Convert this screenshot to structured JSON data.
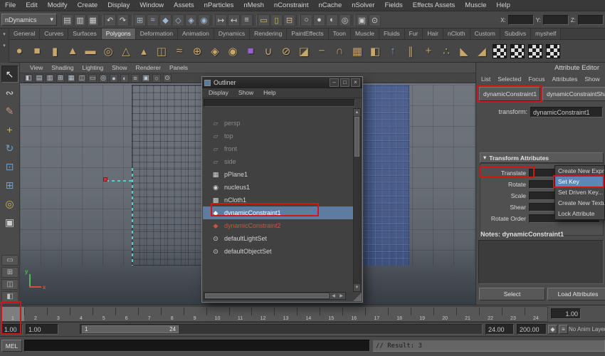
{
  "menubar": {
    "items": [
      "File",
      "Edit",
      "Modify",
      "Create",
      "Display",
      "Window",
      "Assets",
      "nParticles",
      "nMesh",
      "nConstraint",
      "nCache",
      "nSolver",
      "Fields",
      "Effects Assets",
      "Muscle",
      "Help"
    ]
  },
  "statusline": {
    "mode": "nDynamics",
    "caret": "▾",
    "icons": [
      {
        "name": "scene-new-icon",
        "g": "▤",
        "c": "#d0d0d0"
      },
      {
        "name": "scene-open-icon",
        "g": "▥",
        "c": "#d0d0d0"
      },
      {
        "name": "scene-save-icon",
        "g": "▦",
        "c": "#d0d0d0"
      },
      {
        "name": "separator",
        "sep": true
      },
      {
        "name": "undo-icon",
        "g": "↶",
        "c": "#d0d0d0"
      },
      {
        "name": "redo-icon",
        "g": "↷",
        "c": "#d0d0d0"
      },
      {
        "name": "separator",
        "sep": true
      },
      {
        "name": "snap-grid-icon",
        "g": "⊞",
        "c": "#9db7d8"
      },
      {
        "name": "snap-curve-icon",
        "g": "≈",
        "c": "#9db7d8"
      },
      {
        "name": "snap-point-icon",
        "g": "◆",
        "c": "#9db7d8"
      },
      {
        "name": "snap-plane-icon",
        "g": "◇",
        "c": "#9db7d8"
      },
      {
        "name": "snap-surface-icon",
        "g": "◈",
        "c": "#9db7d8"
      },
      {
        "name": "make-live-icon",
        "g": "◉",
        "c": "#9db7d8"
      },
      {
        "name": "separator",
        "sep": true
      },
      {
        "name": "input-connections-icon",
        "g": "↦",
        "c": "#d0d0d0"
      },
      {
        "name": "output-connections-icon",
        "g": "↤",
        "c": "#d0d0d0"
      },
      {
        "name": "construction-history-icon",
        "g": "≡",
        "c": "#d0d0d0"
      },
      {
        "name": "separator",
        "sep": true
      },
      {
        "name": "render-current-frame-icon",
        "g": "▭",
        "c": "#d8b66e"
      },
      {
        "name": "ipr-render-icon",
        "g": "▯",
        "c": "#d8b66e"
      },
      {
        "name": "render-settings-icon",
        "g": "⊟",
        "c": "#d8b66e"
      },
      {
        "name": "separator",
        "sep": true
      },
      {
        "name": "selection-mask-hierarchy-icon",
        "g": "○",
        "c": "#cccccc"
      },
      {
        "name": "selection-mask-object-icon",
        "g": "●",
        "c": "#cccccc"
      },
      {
        "name": "selection-mask-component-icon",
        "g": "◐",
        "c": "#cccccc"
      },
      {
        "name": "highlight-selection-icon",
        "g": "◎",
        "c": "#cccccc"
      },
      {
        "name": "separator",
        "sep": true
      },
      {
        "name": "lock-selection-icon",
        "g": "▣",
        "c": "#cccccc"
      },
      {
        "name": "quick-select-icon",
        "g": "⊙",
        "c": "#cccccc"
      }
    ],
    "coords": {
      "x": "X:",
      "y": "Y:",
      "z": "Z:"
    }
  },
  "shelf": {
    "arrow": "▾",
    "tabs": [
      {
        "label": "General"
      },
      {
        "label": "Curves"
      },
      {
        "label": "Surfaces"
      },
      {
        "label": "Polygons",
        "active": true
      },
      {
        "label": "Deformation"
      },
      {
        "label": "Animation"
      },
      {
        "label": "Dynamics"
      },
      {
        "label": "Rendering"
      },
      {
        "label": "PaintEffects"
      },
      {
        "label": "Toon"
      },
      {
        "label": "Muscle"
      },
      {
        "label": "Fluids"
      },
      {
        "label": "Fur"
      },
      {
        "label": "Hair"
      },
      {
        "label": "nCloth"
      },
      {
        "label": "Custom"
      },
      {
        "label": "Subdivs"
      },
      {
        "label": "myshelf"
      }
    ],
    "icons": [
      {
        "name": "poly-sphere-icon",
        "g": "●",
        "c": "#c9a76a"
      },
      {
        "name": "poly-cube-icon",
        "g": "■",
        "c": "#c9a76a"
      },
      {
        "name": "poly-cylinder-icon",
        "g": "▮",
        "c": "#c9a76a"
      },
      {
        "name": "poly-cone-icon",
        "g": "▲",
        "c": "#c9a76a"
      },
      {
        "name": "poly-plane-icon",
        "g": "▬",
        "c": "#c9a76a"
      },
      {
        "name": "poly-torus-icon",
        "g": "◎",
        "c": "#c9a76a"
      },
      {
        "name": "poly-prism-icon",
        "g": "△",
        "c": "#c9a76a"
      },
      {
        "name": "poly-pyramid-icon",
        "g": "▴",
        "c": "#c9a76a"
      },
      {
        "name": "poly-pipe-icon",
        "g": "◫",
        "c": "#c9a76a"
      },
      {
        "name": "poly-helix-icon",
        "g": "≈",
        "c": "#c9a76a"
      },
      {
        "name": "poly-soccerball-icon",
        "g": "⊕",
        "c": "#c9a76a"
      },
      {
        "name": "poly-platonic-icon",
        "g": "◈",
        "c": "#c9a76a"
      },
      {
        "name": "sculpt-geometry-icon",
        "g": "◉",
        "c": "#c9a76a"
      },
      {
        "name": "ncloth-cube-icon",
        "g": "■",
        "c": "#9b5fd0"
      },
      {
        "name": "poly-combine-icon",
        "g": "∪",
        "c": "#c9a76a"
      },
      {
        "name": "poly-separate-icon",
        "g": "⊘",
        "c": "#c9a76a"
      },
      {
        "name": "poly-extract-icon",
        "g": "◪",
        "c": "#c9a76a"
      },
      {
        "name": "poly-boolean-difference-icon",
        "g": "−",
        "c": "#c9a76a"
      },
      {
        "name": "poly-boolean-intersect-icon",
        "g": "∩",
        "c": "#c9a76a"
      },
      {
        "name": "poly-smooth-icon",
        "g": "▦",
        "c": "#c9a76a"
      },
      {
        "name": "poly-mirror-icon",
        "g": "◧",
        "c": "#c9a76a"
      },
      {
        "name": "poly-extrude-icon",
        "g": "↑",
        "c": "#7e97c0"
      },
      {
        "name": "poly-bridge-icon",
        "g": "∥",
        "c": "#c9a76a"
      },
      {
        "name": "poly-append-icon",
        "g": "+",
        "c": "#c9a76a"
      },
      {
        "name": "poly-merge-icon",
        "g": "∴",
        "c": "#c9a76a"
      },
      {
        "name": "poly-bevel-icon",
        "g": "◣",
        "c": "#c9a76a"
      },
      {
        "name": "poly-crease-icon",
        "g": "◢",
        "c": "#c9a76a"
      },
      {
        "name": "texture-checker-icon",
        "checker": true
      },
      {
        "name": "texture-checker-icon",
        "checker": true
      },
      {
        "name": "texture-checker-icon",
        "checker": true
      },
      {
        "name": "texture-checker-icon",
        "checker": true
      }
    ]
  },
  "toolbox": {
    "tools": [
      {
        "name": "select-tool",
        "g": "↖",
        "c": "#e8e8e8",
        "active": true
      },
      {
        "name": "lasso-select-tool",
        "g": "∾",
        "c": "#cfcfcf"
      },
      {
        "name": "paint-select-tool",
        "g": "✎",
        "c": "#cf8f7f"
      },
      {
        "name": "move-tool",
        "g": "+",
        "c": "#c9b35e"
      },
      {
        "name": "rotate-tool",
        "g": "↻",
        "c": "#6f9ec9"
      },
      {
        "name": "scale-tool",
        "g": "⊡",
        "c": "#6f9ec9"
      },
      {
        "name": "universal-manipulator-tool",
        "g": "⊞",
        "c": "#6f9ec9"
      },
      {
        "name": "soft-modification-tool",
        "g": "◎",
        "c": "#c9b35e"
      },
      {
        "name": "last-tool-used",
        "g": "▣",
        "c": "#cfcfcf"
      }
    ],
    "layouts": [
      {
        "name": "layout-single-pane-button",
        "g": "▭"
      },
      {
        "name": "layout-four-pane-button",
        "g": "⊞"
      },
      {
        "name": "layout-two-pane-button",
        "g": "◫"
      },
      {
        "name": "layout-persp-outliner-button",
        "g": "◧"
      }
    ]
  },
  "viewport": {
    "menus": [
      "View",
      "Shading",
      "Lighting",
      "Show",
      "Renderer",
      "Panels"
    ],
    "icons": [
      {
        "name": "select-camera-icon",
        "g": "◧"
      },
      {
        "name": "lock-camera-icon",
        "g": "▤"
      },
      {
        "name": "camera-attributes-icon",
        "g": "▥"
      },
      {
        "name": "grid-toggle-icon",
        "g": "⊞"
      },
      {
        "name": "film-gate-icon",
        "g": "▦"
      },
      {
        "name": "resolution-gate-icon",
        "g": "◫"
      },
      {
        "name": "gate-mask-icon",
        "g": "▭"
      },
      {
        "name": "safe-action-icon",
        "g": "◎"
      },
      {
        "name": "shaded-mode-icon",
        "g": "●"
      },
      {
        "name": "textured-mode-icon",
        "g": "◐"
      },
      {
        "name": "wireframe-mode-icon",
        "g": "≡"
      },
      {
        "name": "xray-icon",
        "g": "▣"
      },
      {
        "name": "lights-toggle-icon",
        "g": "○"
      },
      {
        "name": "isolate-select-icon",
        "g": "⊙"
      }
    ],
    "axis": {
      "x": "x",
      "y": "y"
    }
  },
  "outliner": {
    "title": "Outliner",
    "window_buttons": [
      {
        "name": "minimize-button",
        "g": "–"
      },
      {
        "name": "maximize-button",
        "g": "□"
      },
      {
        "name": "close-button",
        "g": "×"
      }
    ],
    "menus": [
      "Display",
      "Show",
      "Help"
    ],
    "items": [
      {
        "name": "outliner-item-persp",
        "label": "persp",
        "icon": "▱",
        "c": "#8b8b8b",
        "dim": true
      },
      {
        "name": "outliner-item-top",
        "label": "top",
        "icon": "▱",
        "c": "#8b8b8b",
        "dim": true
      },
      {
        "name": "outliner-item-front",
        "label": "front",
        "icon": "▱",
        "c": "#8b8b8b",
        "dim": true
      },
      {
        "name": "outliner-item-side",
        "label": "side",
        "icon": "▱",
        "c": "#8b8b8b",
        "dim": true
      },
      {
        "name": "outliner-item-pplane1",
        "label": "pPlane1",
        "icon": "▦",
        "c": "#d2d2d2"
      },
      {
        "name": "outliner-item-nucleus1",
        "label": "nucleus1",
        "icon": "◉",
        "c": "#d2d2d2"
      },
      {
        "name": "outliner-item-ncloth1",
        "label": "nCloth1",
        "icon": "▩",
        "c": "#d2d2d2"
      },
      {
        "name": "outliner-item-dynamicconstraint1",
        "label": "dynamicConstraint1",
        "icon": "◆",
        "c": "#ffffff",
        "selected": true
      },
      {
        "name": "outliner-item-dynamicconstraint2",
        "label": "dynamicConstraint2",
        "icon": "◆",
        "c": "#cd5240",
        "red": true
      },
      {
        "name": "outliner-item-defaultlightset",
        "label": "defaultLightSet",
        "icon": "⊙",
        "c": "#d2d2d2"
      },
      {
        "name": "outliner-item-defaultobjectset",
        "label": "defaultObjectSet",
        "icon": "⊙",
        "c": "#d2d2d2"
      }
    ],
    "scroll_up": "▲",
    "scroll_down": "▼",
    "scroll_left": "◀",
    "scroll_right": "▶"
  },
  "attribute_editor": {
    "panel_title": "Attribute Editor",
    "menus": [
      "List",
      "Selected",
      "Focus",
      "Attributes",
      "Show"
    ],
    "tabs": [
      {
        "label": "dynamicConstraint1"
      },
      {
        "label": "dynamicConstraintShape"
      }
    ],
    "transform_label": "transform:",
    "transform_value": "dynamicConstraint1",
    "section_arrow": "▾",
    "section_title": "Transform Attributes",
    "rows": [
      {
        "label": "Translate"
      },
      {
        "label": "Rotate"
      },
      {
        "label": "Scale"
      },
      {
        "label": "Shear"
      },
      {
        "label": "Rotate Order"
      }
    ],
    "context_menu": [
      {
        "label": "Create New Expre"
      },
      {
        "label": "Set Key",
        "selected": true
      },
      {
        "label": "Set Driven Key..."
      },
      {
        "label": "Create New Textu"
      },
      {
        "label": "Lock Attribute"
      }
    ],
    "notes_label": "Notes: dynamicConstraint1",
    "select_button": "Select",
    "load_button": "Load Attributes"
  },
  "timeline": {
    "ticks": [
      {
        "n": "1",
        "current": true
      },
      {
        "n": "2"
      },
      {
        "n": "3"
      },
      {
        "n": "4"
      },
      {
        "n": "5"
      },
      {
        "n": "6"
      },
      {
        "n": "7"
      },
      {
        "n": "8"
      },
      {
        "n": "9"
      },
      {
        "n": "10"
      },
      {
        "n": "11"
      },
      {
        "n": "12"
      },
      {
        "n": "13"
      },
      {
        "n": "14"
      },
      {
        "n": "15"
      },
      {
        "n": "16"
      },
      {
        "n": "17"
      },
      {
        "n": "18"
      },
      {
        "n": "19"
      },
      {
        "n": "20"
      },
      {
        "n": "21"
      },
      {
        "n": "22"
      },
      {
        "n": "23"
      },
      {
        "n": "24"
      }
    ],
    "current_time": "1.00"
  },
  "range": {
    "anim_start": "1.00",
    "play_start": "1.00",
    "in_label": "1",
    "out_label": "24",
    "play_end": "24.00",
    "anim_end": "200.00",
    "buttons": [
      {
        "name": "auto-keyframe-button",
        "g": "◆",
        "c": "#c24d3f"
      },
      {
        "name": "animation-preferences-button",
        "g": "≡",
        "c": "#bbbbbb"
      }
    ],
    "anim_layer": "No Anim Layer"
  },
  "command": {
    "label": "MEL",
    "result": "// Result: 3"
  }
}
